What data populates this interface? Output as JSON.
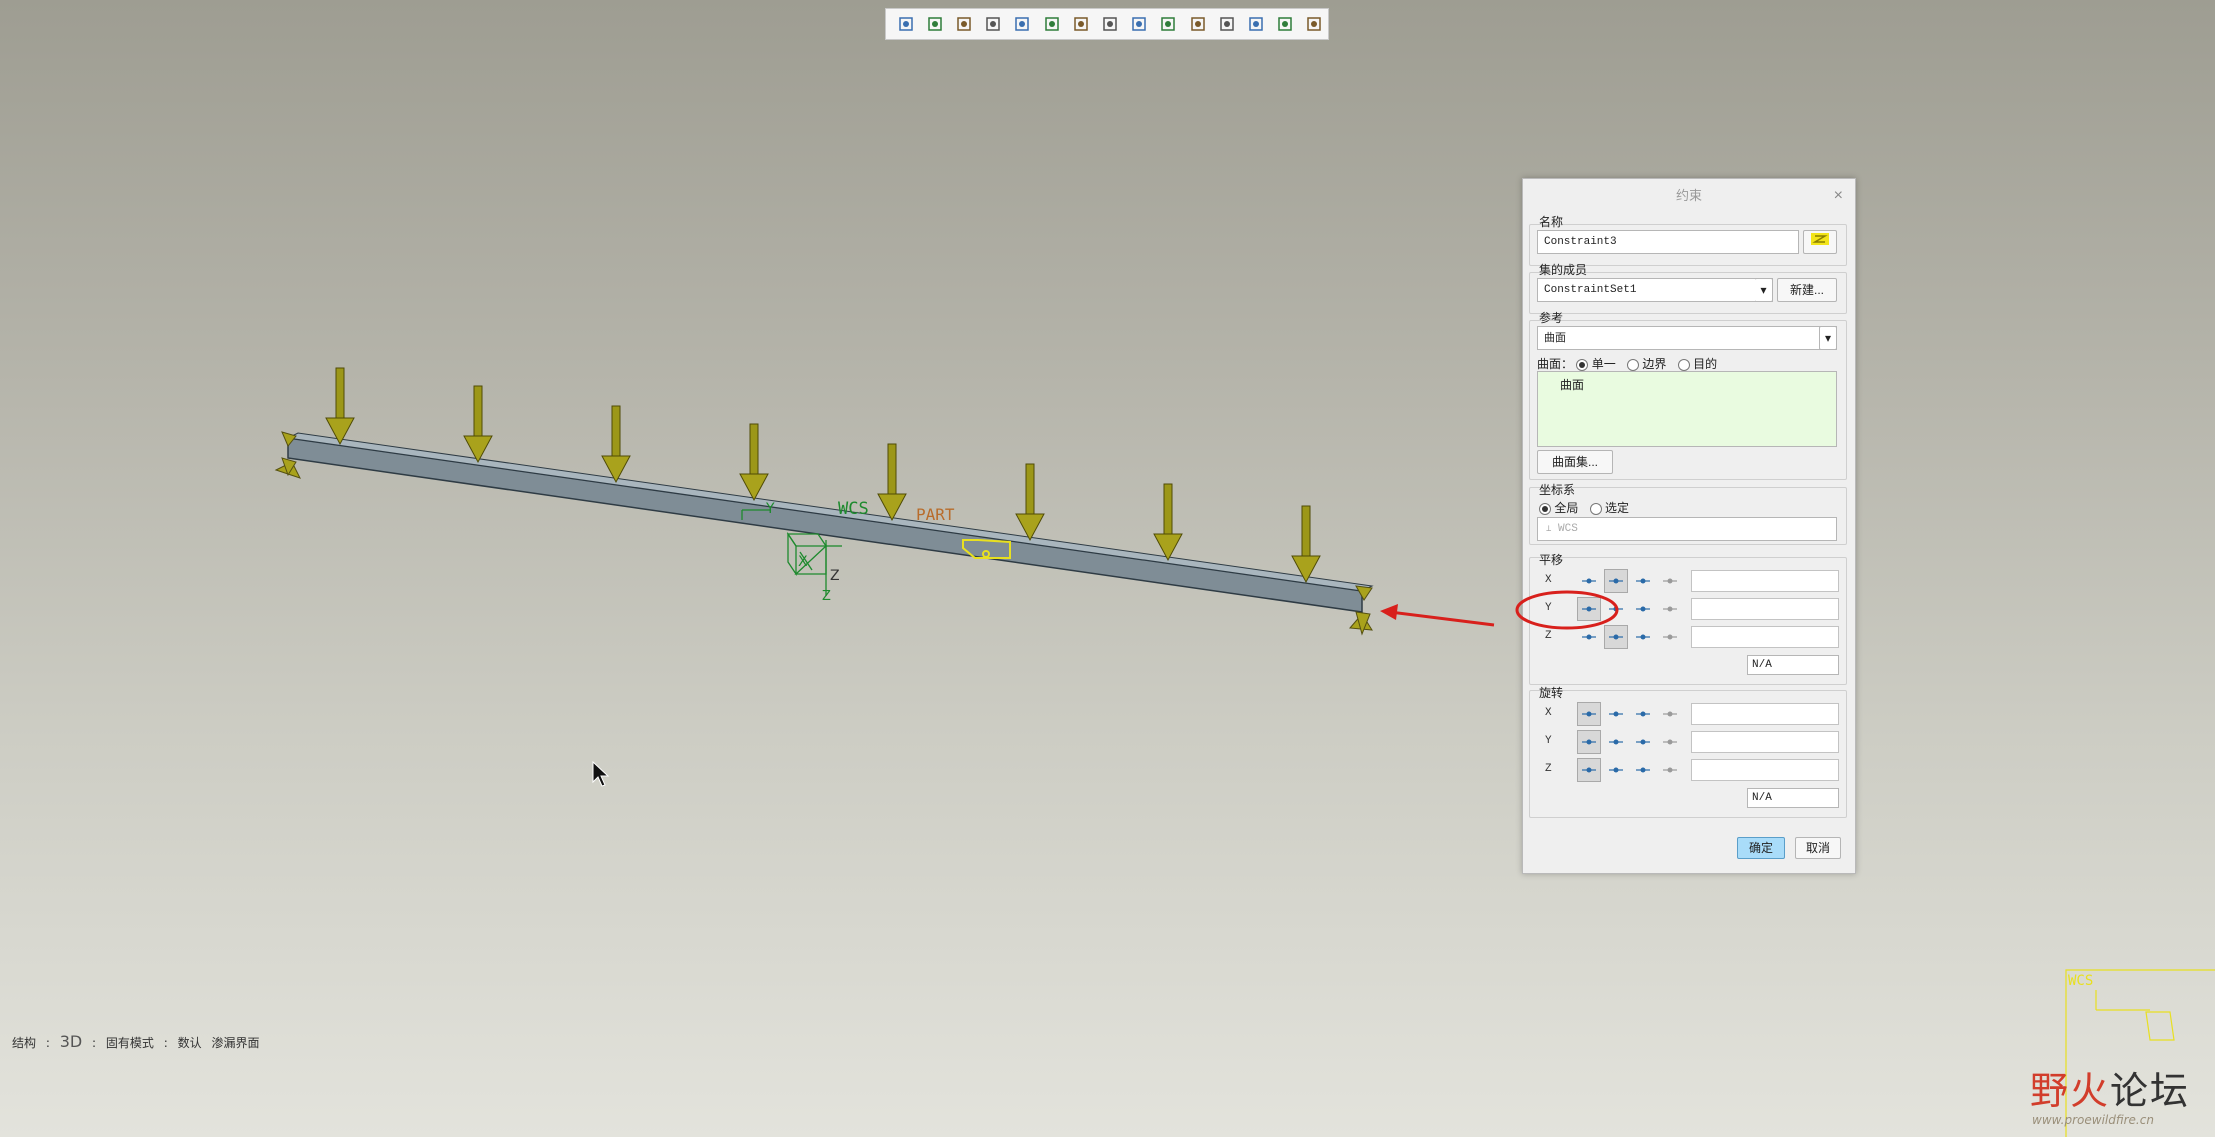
{
  "toolbar": {
    "icons": [
      "refit-icon",
      "zoom-in-icon",
      "zoom-out-icon",
      "repaint-icon",
      "display-style-icon",
      "saved-views-icon",
      "view-manager-icon",
      "section-icon",
      "datum-display-icon",
      "annotation-display-icon",
      "spin-center-icon",
      "datum-planes-icon",
      "datum-axes-icon",
      "datum-points-icon",
      "csys-display-icon"
    ]
  },
  "model": {
    "wcs_label": "WCS",
    "part_label": "PART",
    "axis_y": "Y",
    "axis_x": "X",
    "axis_z": "Z"
  },
  "status": {
    "item1": "结构",
    "sep": ":",
    "item2": "3D",
    "item3": "固有模式",
    "item4": "数认",
    "item5": "渗漏界面"
  },
  "dialog": {
    "title": "约束",
    "close": "×",
    "name_label": "名称",
    "name_value": "Constraint3",
    "set_label": "集的成员",
    "set_value": "ConstraintSet1",
    "new_button": "新建...",
    "ref_label": "参考",
    "ref_type": "曲面",
    "surface_label": "曲面：",
    "opt_single": "单一",
    "opt_boundary": "边界",
    "opt_intent": "目的",
    "collector_item": "曲面",
    "surface_set_button": "曲面集...",
    "csys_label": "坐标系",
    "csys_global": "全局",
    "csys_selected": "选定",
    "csys_value": "WCS",
    "translation_label": "平移",
    "rotation_label": "旋转",
    "axes": [
      "X",
      "Y",
      "Z"
    ],
    "na": "N/A",
    "ok_button": "确定",
    "cancel_button": "取消"
  },
  "watermark": {
    "text1": "野火",
    "text2": "论坛",
    "url": "www.proewildfire.cn",
    "wcs": "WCS"
  },
  "colors": {
    "arrow_load": "#8c8a12",
    "beam": "#7d8b94",
    "highlight_ring": "#d8201c",
    "ok_blue": "#a9dcf9"
  }
}
